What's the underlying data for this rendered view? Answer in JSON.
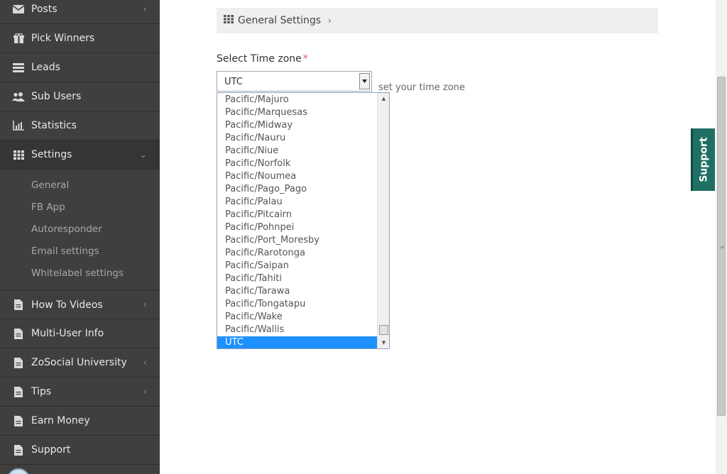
{
  "sidebar": {
    "items": [
      {
        "label": "Posts",
        "icon": "envelope-icon",
        "caret": "‹"
      },
      {
        "label": "Pick Winners",
        "icon": "gift-icon",
        "caret": ""
      },
      {
        "label": "Leads",
        "icon": "list-icon",
        "caret": ""
      },
      {
        "label": "Sub Users",
        "icon": "users-icon",
        "caret": ""
      },
      {
        "label": "Statistics",
        "icon": "bar-chart-icon",
        "caret": ""
      },
      {
        "label": "Settings",
        "icon": "grid-icon",
        "caret": "⌄"
      },
      {
        "label": "How To Videos",
        "icon": "file-icon",
        "caret": "‹"
      },
      {
        "label": "Multi-User Info",
        "icon": "file-icon",
        "caret": ""
      },
      {
        "label": "ZoSocial University",
        "icon": "file-icon",
        "caret": "‹"
      },
      {
        "label": "Tips",
        "icon": "file-icon",
        "caret": "‹"
      },
      {
        "label": "Earn Money",
        "icon": "file-icon",
        "caret": ""
      },
      {
        "label": "Support",
        "icon": "file-icon",
        "caret": ""
      }
    ],
    "settings_sub": [
      "General",
      "FB App",
      "Autoresponder",
      "Email settings",
      "Whitelabel settings"
    ]
  },
  "breadcrumb": {
    "label": "General Settings",
    "chevron": "›"
  },
  "timezone": {
    "label": "Select Time zone",
    "required_mark": "*",
    "selected": "UTC",
    "helper": "set your time zone",
    "options": [
      "Pacific/Majuro",
      "Pacific/Marquesas",
      "Pacific/Midway",
      "Pacific/Nauru",
      "Pacific/Niue",
      "Pacific/Norfolk",
      "Pacific/Noumea",
      "Pacific/Pago_Pago",
      "Pacific/Palau",
      "Pacific/Pitcairn",
      "Pacific/Pohnpei",
      "Pacific/Port_Moresby",
      "Pacific/Rarotonga",
      "Pacific/Saipan",
      "Pacific/Tahiti",
      "Pacific/Tarawa",
      "Pacific/Tongatapu",
      "Pacific/Wake",
      "Pacific/Wallis",
      "UTC"
    ]
  },
  "support_tab": "Support",
  "colors": {
    "sidebar": "#3f3f3f",
    "selected_option": "#1e90ff",
    "support": "#1f6f64"
  }
}
